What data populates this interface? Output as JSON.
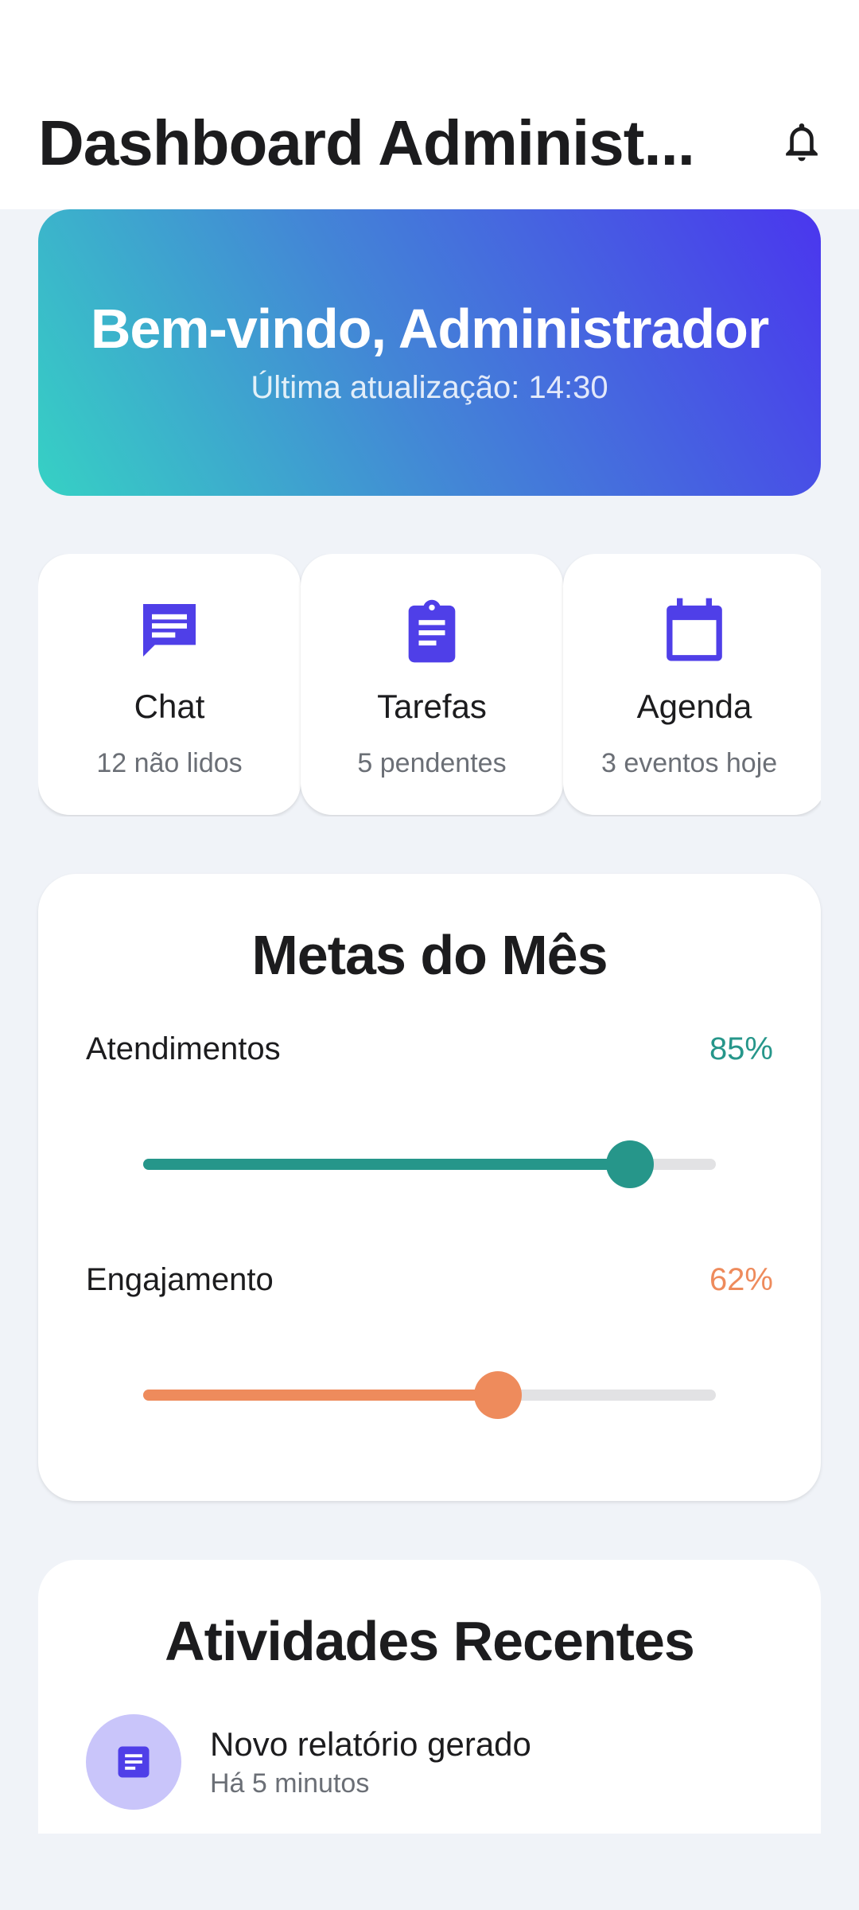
{
  "header": {
    "title": "Dashboard Administ...",
    "bell_icon": "bell-icon"
  },
  "hero": {
    "title": "Bem-vindo, Administrador",
    "subtitle": "Última atualização: 14:30"
  },
  "quick_actions": [
    {
      "label": "Chat",
      "sub": "12 não lidos",
      "icon": "chat-icon"
    },
    {
      "label": "Tarefas",
      "sub": "5 pendentes",
      "icon": "clipboard-icon"
    },
    {
      "label": "Agenda",
      "sub": "3 eventos hoje",
      "icon": "calendar-icon"
    }
  ],
  "goals": {
    "title": "Metas do Mês",
    "items": [
      {
        "label": "Atendimentos",
        "value_text": "85%",
        "value": 0.85,
        "color": "#26968a"
      },
      {
        "label": "Engajamento",
        "value_text": "62%",
        "value": 0.62,
        "color": "#ee8b5c"
      }
    ]
  },
  "recent": {
    "title": "Atividades Recentes",
    "items": [
      {
        "title": "Novo relatório gerado",
        "time": "Há 5 minutos",
        "icon": "document-icon"
      }
    ]
  },
  "colors": {
    "accent": "#4f3fe8",
    "background": "#f0f3f8"
  }
}
